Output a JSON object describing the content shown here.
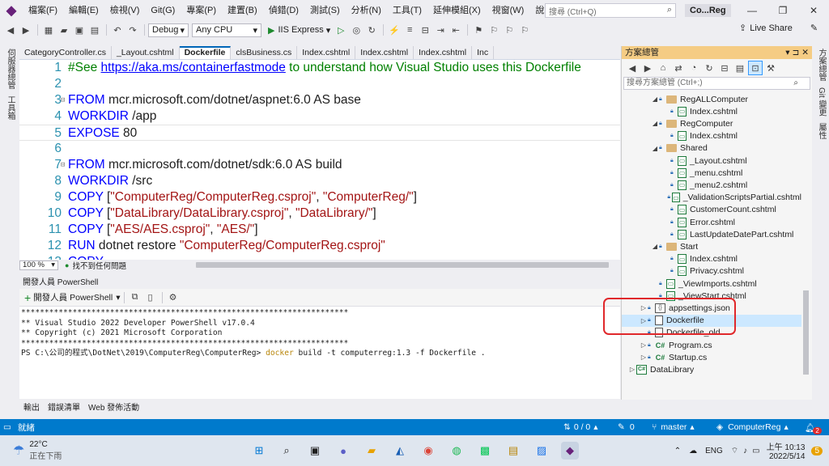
{
  "menu": {
    "items": [
      "檔案(F)",
      "編輯(E)",
      "檢視(V)",
      "Git(G)",
      "專案(P)",
      "建置(B)",
      "偵錯(D)",
      "測試(S)",
      "分析(N)",
      "工具(T)",
      "延伸模組(X)",
      "視窗(W)",
      "說明(H)"
    ],
    "search_placeholder": "搜尋 (Ctrl+Q)",
    "solution_name": "Co...Reg"
  },
  "toolbar": {
    "config": "Debug",
    "platform": "Any CPU",
    "run_label": "IIS Express",
    "live_share": "Live Share"
  },
  "left_strip": [
    "伺服器總管",
    "工具箱"
  ],
  "right_strip": [
    "方案總管",
    "Git 變更",
    "屬性"
  ],
  "doc_tabs": [
    "CategoryController.cs",
    "_Layout.cshtml",
    "Dockerfile",
    "clsBusiness.cs",
    "Index.cshtml",
    "Index.cshtml",
    "Index.cshtml",
    "Inc"
  ],
  "active_tab_index": 2,
  "editor": {
    "lines": [
      {
        "no": "1",
        "text": "#See https://aka.ms/containerfastmode to understand how Visual Studio uses this Dockerfile"
      },
      {
        "no": "2",
        "text": ""
      },
      {
        "no": "3",
        "text": "FROM mcr.microsoft.com/dotnet/aspnet:6.0 AS base"
      },
      {
        "no": "4",
        "text": "WORKDIR /app"
      },
      {
        "no": "5",
        "text": "EXPOSE 80"
      },
      {
        "no": "6",
        "text": ""
      },
      {
        "no": "7",
        "text": "FROM mcr.microsoft.com/dotnet/sdk:6.0 AS build"
      },
      {
        "no": "8",
        "text": "WORKDIR /src"
      },
      {
        "no": "9",
        "text": "COPY [\"ComputerReg/ComputerReg.csproj\", \"ComputerReg/\"]"
      },
      {
        "no": "10",
        "text": "COPY [\"DataLibrary/DataLibrary.csproj\", \"DataLibrary/\"]"
      },
      {
        "no": "11",
        "text": "COPY [\"AES/AES.csproj\", \"AES/\"]"
      },
      {
        "no": "12",
        "text": "RUN dotnet restore \"ComputerReg/ComputerReg.csproj\""
      },
      {
        "no": "13",
        "text": "COPY"
      }
    ],
    "comment_prefix": "#See ",
    "comment_link": "https://aka.ms/containerfastmode",
    "comment_suffix": " to understand how Visual Studio uses this Dockerfile",
    "zoom": "100 %",
    "issues": "找不到任何問題"
  },
  "powershell": {
    "title": "開發人員 PowerShell",
    "new_button": "開發人員 PowerShell",
    "output": [
      "**********************************************************************",
      "** Visual Studio 2022 Developer PowerShell v17.0.4",
      "** Copyright (c) 2021 Microsoft Corporation",
      "**********************************************************************"
    ],
    "prompt": "PS C:\\公司的程式\\DotNet\\2019\\ComputerReg\\ComputerReg> ",
    "cmd": "docker",
    "args": " build -t computerreg:1.3 -f Dockerfile ."
  },
  "bottom_tabs": [
    "輸出",
    "錯誤清單",
    "Web 發佈活動"
  ],
  "solution_explorer": {
    "title": "方案總管",
    "search_placeholder": "搜尋方案總管 (Ctrl+;)",
    "items": [
      {
        "label": "RegALLComputer",
        "type": "folder",
        "indent": 2,
        "expanded": true
      },
      {
        "label": "Index.cshtml",
        "type": "page",
        "indent": 3
      },
      {
        "label": "RegComputer",
        "type": "folder",
        "indent": 2,
        "expanded": true
      },
      {
        "label": "Index.cshtml",
        "type": "page",
        "indent": 3
      },
      {
        "label": "Shared",
        "type": "folder",
        "indent": 2,
        "expanded": true
      },
      {
        "label": "_Layout.cshtml",
        "type": "page",
        "indent": 3
      },
      {
        "label": "_menu.cshtml",
        "type": "page",
        "indent": 3
      },
      {
        "label": "_menu2.cshtml",
        "type": "page",
        "indent": 3
      },
      {
        "label": "_ValidationScriptsPartial.cshtml",
        "type": "page",
        "indent": 3
      },
      {
        "label": "CustomerCount.cshtml",
        "type": "page",
        "indent": 3
      },
      {
        "label": "Error.cshtml",
        "type": "page",
        "indent": 3
      },
      {
        "label": "LastUpdateDatePart.cshtml",
        "type": "page",
        "indent": 3
      },
      {
        "label": "Start",
        "type": "folder",
        "indent": 2,
        "expanded": true
      },
      {
        "label": "Index.cshtml",
        "type": "page",
        "indent": 3
      },
      {
        "label": "Privacy.cshtml",
        "type": "page",
        "indent": 3
      },
      {
        "label": "_ViewImports.cshtml",
        "type": "page",
        "indent": 2
      },
      {
        "label": "_ViewStart.cshtml",
        "type": "page",
        "indent": 2
      },
      {
        "label": "appsettings.json",
        "type": "json",
        "indent": 1,
        "collapsed": true
      },
      {
        "label": "Dockerfile",
        "type": "doc",
        "indent": 1,
        "collapsed": true,
        "selected": true
      },
      {
        "label": "Dockerfile_old",
        "type": "doc",
        "indent": 1
      },
      {
        "label": "Program.cs",
        "type": "cs",
        "indent": 1,
        "collapsed": true
      },
      {
        "label": "Startup.cs",
        "type": "cs",
        "indent": 1,
        "collapsed": true
      },
      {
        "label": "DataLibrary",
        "type": "proj",
        "indent": 0,
        "collapsed": true
      }
    ]
  },
  "statusbar": {
    "ready": "就緒",
    "changes": "0 / 0",
    "pencil_count": "0",
    "branch": "master",
    "repo": "ComputerReg",
    "notifications": "2"
  },
  "taskbar": {
    "temp": "22°C",
    "weather": "正在下雨",
    "lang": "ENG",
    "time": "上午 10:13",
    "date": "2022/5/14",
    "notif": "5"
  },
  "colors": {
    "accent": "#007acc",
    "solution_explorer_title": "#f5cc84",
    "annotation": "#e0282b"
  }
}
